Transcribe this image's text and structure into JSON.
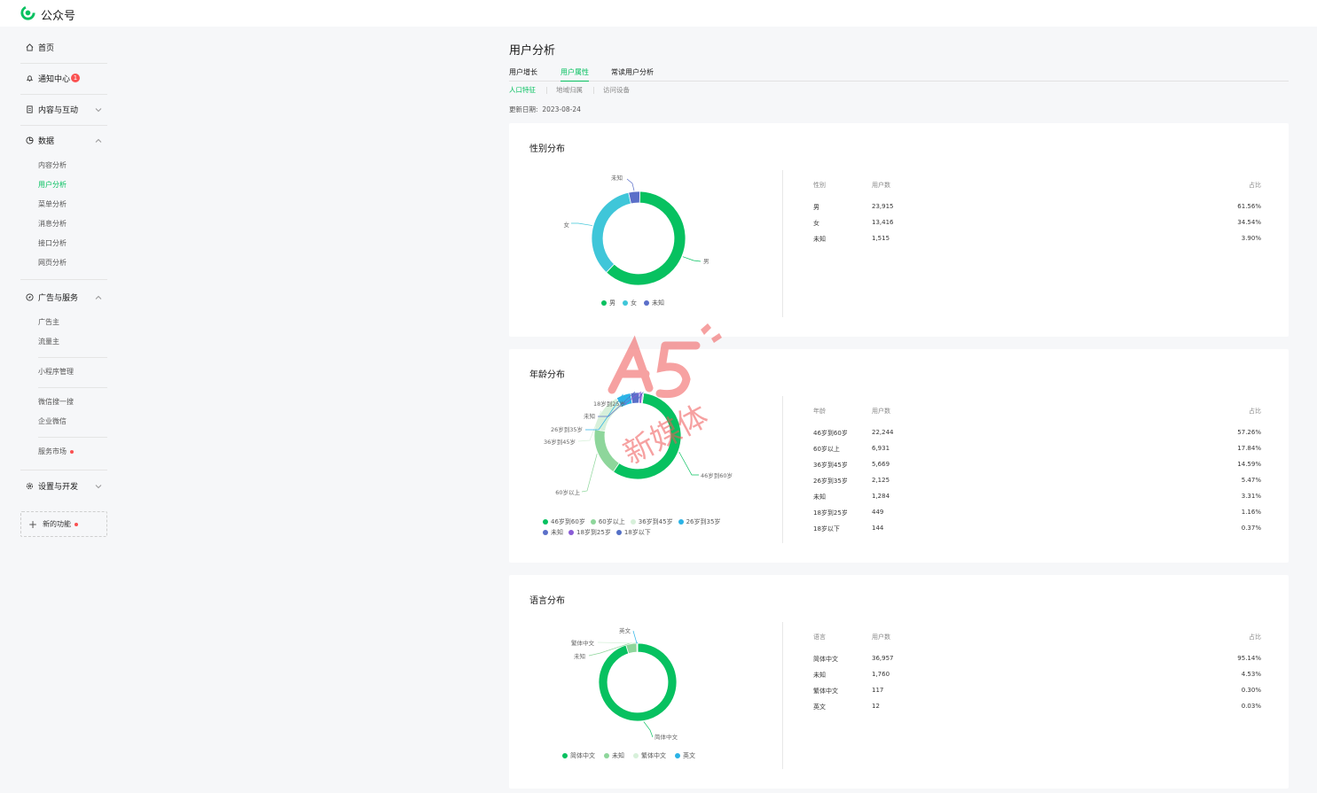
{
  "app": {
    "brand": "公众号",
    "logo_icon": "wechat-logo-icon"
  },
  "sidebar": {
    "home": "首页",
    "notifications": {
      "label": "通知中心",
      "badge": "1"
    },
    "content": "内容与互动",
    "data": {
      "label": "数据",
      "items": [
        "内容分析",
        "用户分析",
        "菜单分析",
        "消息分析",
        "接口分析",
        "网页分析"
      ],
      "active": "用户分析"
    },
    "ads": {
      "label": "广告与服务",
      "items": [
        "广告主",
        "流量主"
      ]
    },
    "mini_program": "小程序管理",
    "wecom": [
      "微信搜一搜",
      "企业微信"
    ],
    "service_market": "服务市场",
    "settings": "设置与开发",
    "new_feature": "新的功能"
  },
  "page": {
    "title": "用户分析",
    "tabs": [
      "用户增长",
      "用户属性",
      "常读用户分析"
    ],
    "active_tab": "用户属性",
    "subtabs": [
      "人口特征",
      "地域归属",
      "访问设备"
    ],
    "active_subtab": "人口特征",
    "update_label": "更新日期:",
    "update_date": "2023-08-24"
  },
  "colors": {
    "accent": "#07c160",
    "green": "#07c160",
    "cyan": "#3fc6d9",
    "purple": "#5b6fc9",
    "light_green": "#8ed69b",
    "pale_green": "#d7f0da",
    "teal": "#2bb3e6",
    "violet": "#8a5cd6"
  },
  "gender": {
    "title": "性别分布",
    "headers": [
      "性别",
      "用户数",
      "占比"
    ],
    "rows": [
      {
        "name": "男",
        "count": "23,915",
        "pct": "61.56%"
      },
      {
        "name": "女",
        "count": "13,416",
        "pct": "34.54%"
      },
      {
        "name": "未知",
        "count": "1,515",
        "pct": "3.90%"
      }
    ],
    "legend": [
      "男",
      "女",
      "未知"
    ]
  },
  "age": {
    "title": "年龄分布",
    "headers": [
      "年龄",
      "用户数",
      "占比"
    ],
    "rows": [
      {
        "name": "46岁到60岁",
        "count": "22,244",
        "pct": "57.26%"
      },
      {
        "name": "60岁以上",
        "count": "6,931",
        "pct": "17.84%"
      },
      {
        "name": "36岁到45岁",
        "count": "5,669",
        "pct": "14.59%"
      },
      {
        "name": "26岁到35岁",
        "count": "2,125",
        "pct": "5.47%"
      },
      {
        "name": "未知",
        "count": "1,284",
        "pct": "3.31%"
      },
      {
        "name": "18岁到25岁",
        "count": "449",
        "pct": "1.16%"
      },
      {
        "name": "18岁以下",
        "count": "144",
        "pct": "0.37%"
      }
    ],
    "legend": [
      "46岁到60岁",
      "60岁以上",
      "36岁到45岁",
      "26岁到35岁",
      "未知",
      "18岁到25岁",
      "18岁以下"
    ]
  },
  "language": {
    "title": "语言分布",
    "headers": [
      "语言",
      "用户数",
      "占比"
    ],
    "rows": [
      {
        "name": "简体中文",
        "count": "36,957",
        "pct": "95.14%"
      },
      {
        "name": "未知",
        "count": "1,760",
        "pct": "4.53%"
      },
      {
        "name": "繁体中文",
        "count": "117",
        "pct": "0.30%"
      },
      {
        "name": "英文",
        "count": "12",
        "pct": "0.03%"
      }
    ],
    "legend": [
      "简体中文",
      "未知",
      "繁体中文",
      "英文"
    ]
  },
  "chart_data": [
    {
      "type": "pie",
      "title": "性别分布",
      "categories": [
        "男",
        "女",
        "未知"
      ],
      "values": [
        61.56,
        34.54,
        3.9
      ],
      "legend": "bottom"
    },
    {
      "type": "pie",
      "title": "年龄分布",
      "categories": [
        "46岁到60岁",
        "60岁以上",
        "36岁到45岁",
        "26岁到35岁",
        "未知",
        "18岁到25岁",
        "18岁以下"
      ],
      "values": [
        57.26,
        17.84,
        14.59,
        5.47,
        3.31,
        1.16,
        0.37
      ],
      "legend": "bottom"
    },
    {
      "type": "pie",
      "title": "语言分布",
      "categories": [
        "简体中文",
        "未知",
        "繁体中文",
        "英文"
      ],
      "values": [
        95.14,
        4.53,
        0.3,
        0.03
      ],
      "legend": "bottom"
    }
  ],
  "watermark": {
    "text": "A5新媒体"
  }
}
